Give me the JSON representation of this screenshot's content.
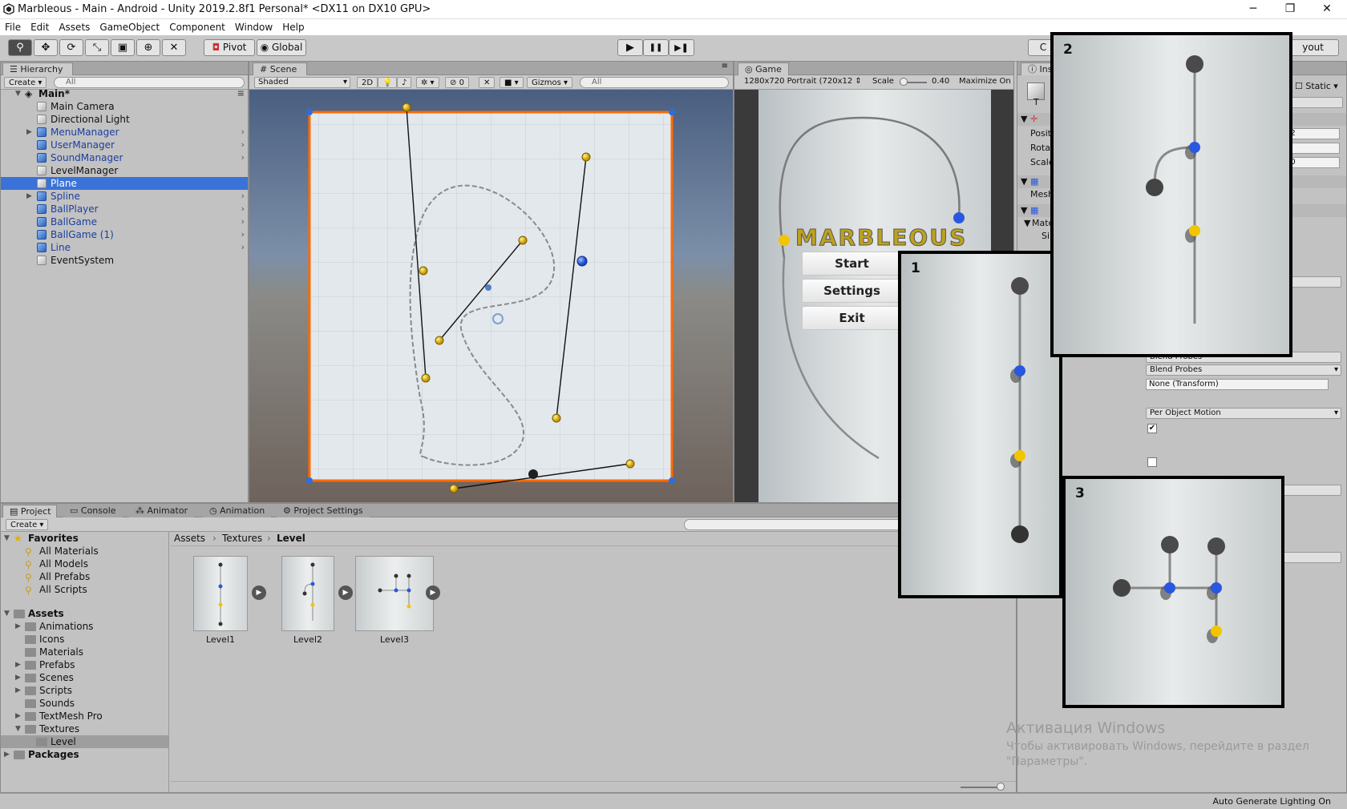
{
  "window": {
    "title": "Marbleous - Main - Android - Unity 2019.2.8f1 Personal* <DX11 on DX10 GPU>",
    "minimize": "─",
    "maximize": "❐",
    "close": "✕"
  },
  "menu": [
    "File",
    "Edit",
    "Assets",
    "GameObject",
    "Component",
    "Window",
    "Help"
  ],
  "toolbar": {
    "tools": [
      "hand-tool",
      "move-tool",
      "rotate-tool",
      "scale-tool",
      "rect-tool",
      "transform-tool",
      "custom-tool"
    ],
    "pivot": "Pivot",
    "global": "Global",
    "play": "▶",
    "pause": "❚❚",
    "step": "▶❚",
    "collab": "C",
    "layout": "yout"
  },
  "hierarchy": {
    "tab": "Hierarchy",
    "create": "Create",
    "search_placeholder": "All",
    "scene": "Main*",
    "items": [
      {
        "label": "Main Camera",
        "prefab": false,
        "expandable": false
      },
      {
        "label": "Directional Light",
        "prefab": false,
        "expandable": false
      },
      {
        "label": "MenuManager",
        "prefab": true,
        "expandable": true
      },
      {
        "label": "UserManager",
        "prefab": true,
        "expandable": false
      },
      {
        "label": "SoundManager",
        "prefab": true,
        "expandable": false
      },
      {
        "label": "LevelManager",
        "prefab": false,
        "expandable": false
      },
      {
        "label": "Plane",
        "prefab": false,
        "expandable": false,
        "selected": true
      },
      {
        "label": "Spline",
        "prefab": true,
        "expandable": true
      },
      {
        "label": "BallPlayer",
        "prefab": true,
        "expandable": false
      },
      {
        "label": "BallGame",
        "prefab": true,
        "expandable": false
      },
      {
        "label": "BallGame (1)",
        "prefab": true,
        "expandable": false
      },
      {
        "label": "Line",
        "prefab": true,
        "expandable": false
      },
      {
        "label": "EventSystem",
        "prefab": false,
        "expandable": false
      }
    ]
  },
  "scene": {
    "tab": "Scene",
    "shading": "Shaded",
    "mode_2d": "2D",
    "hidden_count": "0",
    "gizmos": "Gizmos",
    "search_placeholder": "All"
  },
  "game": {
    "tab": "Game",
    "resolution": "1280x720 Portrait (720x12",
    "scale_label": "Scale",
    "scale_value": "0.40",
    "maximize": "Maximize On P",
    "title_text": "MARBLEOUS",
    "buttons": [
      "Start",
      "Settings",
      "Exit"
    ]
  },
  "inspector": {
    "tab": "Ins",
    "static": "Static",
    "t_label": "T",
    "rows": [
      "Posit",
      "Rotat",
      "Scale"
    ],
    "row_values": [
      "72",
      "0",
      "10"
    ],
    "mesh_label": "Mesh",
    "mat_label": "Mate",
    "si_label": "Si",
    "blend_probes": "Blend Probes",
    "none_transform": "None (Transform)",
    "motion": "Per Object Motion",
    "blend_partial": "Blend Probes"
  },
  "project": {
    "tabs": [
      "Project",
      "Console",
      "Animator",
      "Animation",
      "Project Settings"
    ],
    "create": "Create",
    "favorites_label": "Favorites",
    "favorites": [
      "All Materials",
      "All Models",
      "All Prefabs",
      "All Scripts"
    ],
    "assets_label": "Assets",
    "assets": [
      {
        "label": "Animations",
        "expandable": true
      },
      {
        "label": "Icons",
        "expandable": false
      },
      {
        "label": "Materials",
        "expandable": false
      },
      {
        "label": "Prefabs",
        "expandable": true
      },
      {
        "label": "Scenes",
        "expandable": true
      },
      {
        "label": "Scripts",
        "expandable": true
      },
      {
        "label": "Sounds",
        "expandable": false
      },
      {
        "label": "TextMesh Pro",
        "expandable": true
      },
      {
        "label": "Textures",
        "expandable": true,
        "open": true
      }
    ],
    "subfolder": "Level",
    "packages_label": "Packages",
    "breadcrumb": [
      "Assets",
      "Textures",
      "Level"
    ],
    "files": [
      "Level1",
      "Level2",
      "Level3"
    ]
  },
  "overlays": {
    "labels": [
      "1",
      "2",
      "3"
    ]
  },
  "watermark": {
    "line1": "Активация Windows",
    "line2": "Чтобы активировать Windows, перейдите в раздел",
    "line3": "\"Параметры\"."
  },
  "status": {
    "right": "Auto Generate Lighting On"
  },
  "colors": {
    "selection": "#3a72d8",
    "scene_border": "#ff6a00",
    "marble_yellow": "#f2c500",
    "marble_blue": "#2a57e0",
    "marble_dark": "#4a4a4a"
  }
}
